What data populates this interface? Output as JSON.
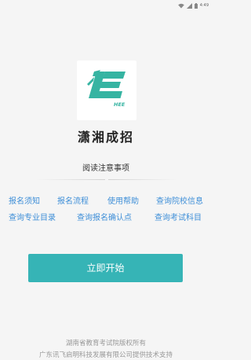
{
  "status_bar": {
    "time": "4:49",
    "icons": [
      "wifi-icon",
      "cellular-signal-icon",
      "battery-icon"
    ]
  },
  "app": {
    "title": "潇湘成招",
    "logo_text": "HEE",
    "logo_color": "#36b4a2"
  },
  "notice": {
    "header": "阅读注意事项",
    "links": [
      "报名须知",
      "报名流程",
      "使用帮助",
      "查询院校信息",
      "查询专业目录",
      "查询报名确认点",
      "查询考试科目"
    ],
    "link_color": "#3f8fd8"
  },
  "start_button": {
    "label": "立即开始",
    "color": "#36b4b6"
  },
  "footer": {
    "copyright": "湖南省教育考试院版权所有",
    "support": "广东讯飞启明科技发展有限公司提供技术支持"
  }
}
